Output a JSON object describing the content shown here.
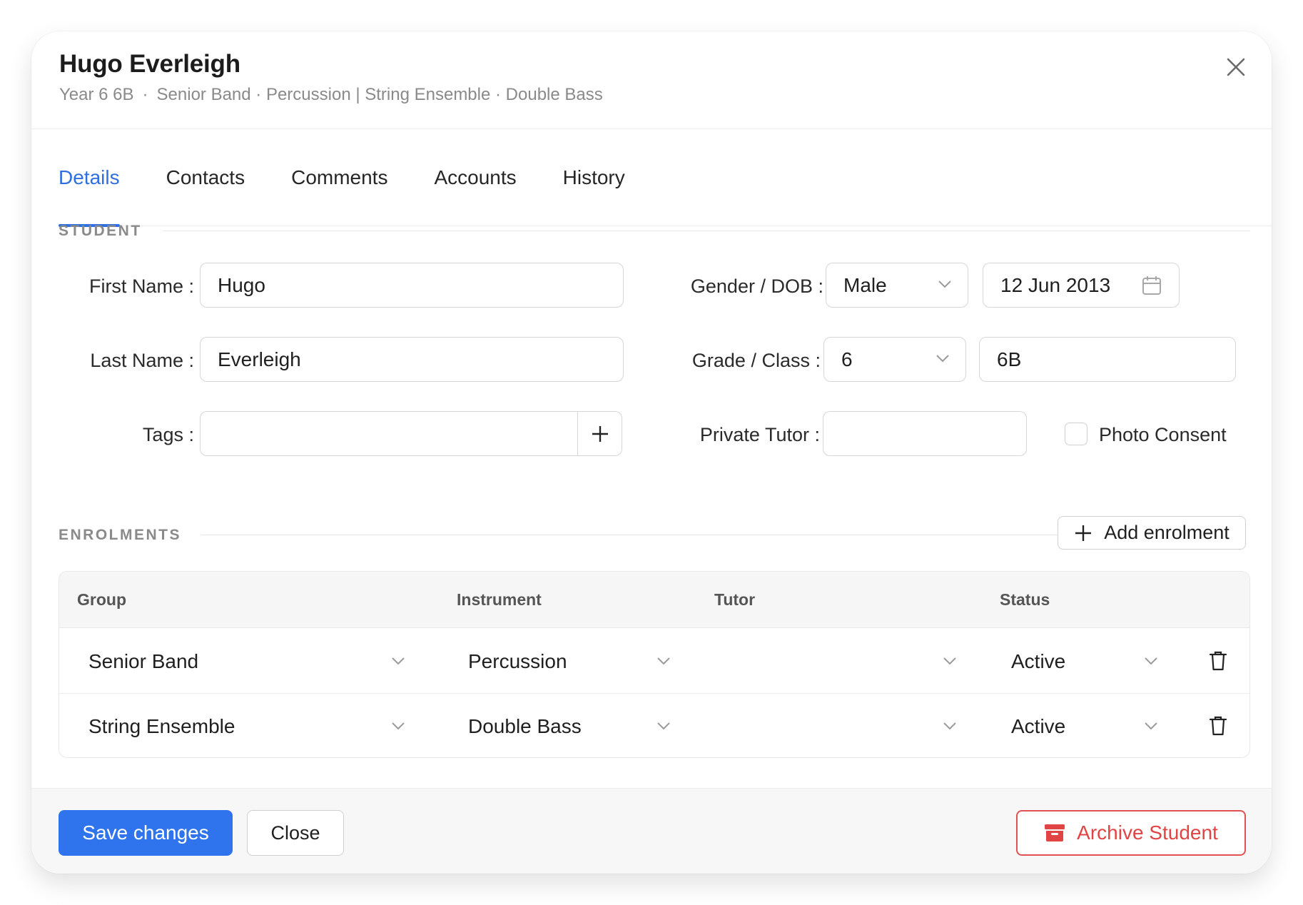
{
  "header": {
    "title": "Hugo Everleigh",
    "subtitle_year": "Year 6 6B",
    "subtitle_sep": "·",
    "subtitle_enrolments": "Senior Band · Percussion | String Ensemble · Double Bass"
  },
  "tabs": [
    {
      "label": "Details",
      "active": true
    },
    {
      "label": "Contacts",
      "active": false
    },
    {
      "label": "Comments",
      "active": false
    },
    {
      "label": "Accounts",
      "active": false
    },
    {
      "label": "History",
      "active": false
    }
  ],
  "student": {
    "section_label": "STUDENT",
    "first_name_label": "First Name",
    "first_name_value": "Hugo",
    "last_name_label": "Last Name",
    "last_name_value": "Everleigh",
    "tags_label": "Tags",
    "tags_value": "",
    "gender_dob_label": "Gender / DOB",
    "gender_value": "Male",
    "dob_value": "12 Jun 2013",
    "grade_class_label": "Grade / Class",
    "grade_value": "6",
    "class_value": "6B",
    "private_tutor_label": "Private Tutor",
    "private_tutor_value": "",
    "photo_consent_label": "Photo Consent",
    "photo_consent_checked": false,
    "colon": ":"
  },
  "enrolments": {
    "section_label": "ENROLMENTS",
    "add_label": "Add enrolment",
    "columns": [
      "Group",
      "Instrument",
      "Tutor",
      "Status"
    ],
    "rows": [
      {
        "group": "Senior Band",
        "instrument": "Percussion",
        "tutor": "",
        "status": "Active"
      },
      {
        "group": "String Ensemble",
        "instrument": "Double Bass",
        "tutor": "",
        "status": "Active"
      }
    ]
  },
  "footer": {
    "save_label": "Save changes",
    "close_label": "Close",
    "archive_label": "Archive Student"
  },
  "colors": {
    "accent": "#2f74ec",
    "tab_active": "#2f6fe0",
    "danger": "#e04444"
  }
}
